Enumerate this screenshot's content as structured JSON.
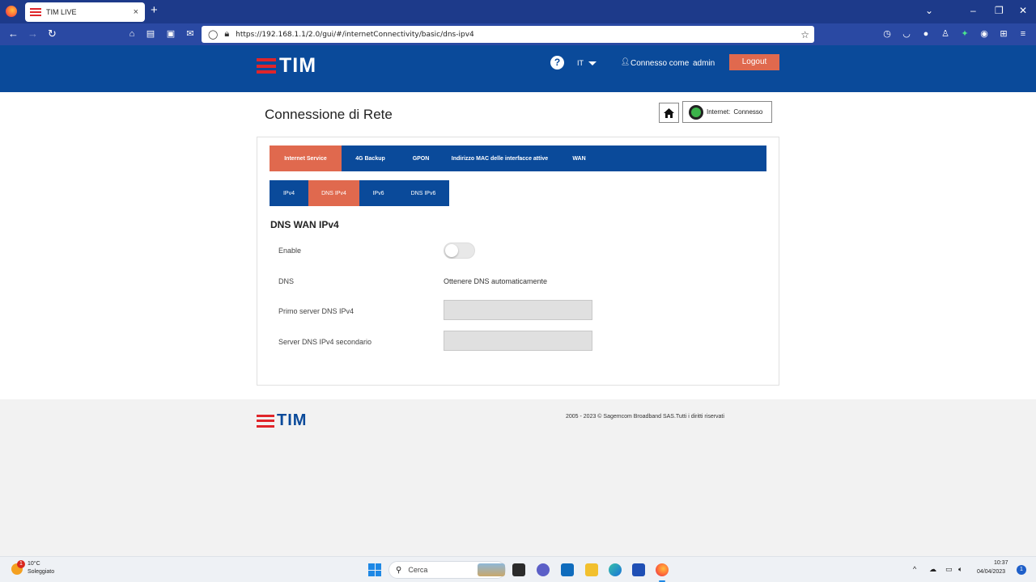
{
  "browser": {
    "tab_title": "TIM LIVE",
    "tab_close": "×",
    "new_tab": "+",
    "url": "https://192.168.1.1/2.0/gui/#/internetConnectivity/basic/dns-ipv4",
    "window_controls": {
      "dropdown": "⌄",
      "minimize": "–",
      "restore": "❐",
      "close": "✕"
    },
    "nav": {
      "back": "←",
      "forward": "→",
      "reload": "↻"
    }
  },
  "header": {
    "brand": "TIM",
    "help": "?",
    "language": "IT",
    "connected_as_label": "Connesso come",
    "username": "admin",
    "logout_label": "Logout"
  },
  "page": {
    "title": "Connessione di Rete",
    "status_label": "Internet:",
    "status_value": "Connesso"
  },
  "tabs_main": [
    {
      "label": "Internet Service",
      "active": true
    },
    {
      "label": "4G Backup",
      "active": false
    },
    {
      "label": "GPON",
      "active": false
    },
    {
      "label": "Indirizzo MAC delle interfacce attive",
      "active": false
    },
    {
      "label": "WAN",
      "active": false
    }
  ],
  "tabs_sub": [
    {
      "label": "IPv4",
      "active": false
    },
    {
      "label": "DNS IPv4",
      "active": true
    },
    {
      "label": "IPv6",
      "active": false
    },
    {
      "label": "DNS IPv6",
      "active": false
    }
  ],
  "form": {
    "section_title": "DNS WAN IPv4",
    "enable_label": "Enable",
    "enable_value": false,
    "dns_label": "DNS",
    "dns_value": "Ottenere DNS automaticamente",
    "primary_label": "Primo server DNS IPv4",
    "primary_value": "",
    "secondary_label": "Server DNS IPv4 secondario",
    "secondary_value": ""
  },
  "footer": {
    "brand": "TIM",
    "copyright": "2005 - 2023 © Sagemcom Broadband SAS.Tutti i diritti riservati"
  },
  "taskbar": {
    "weather_temp": "10°C",
    "weather_desc": "Soleggiato",
    "weather_badge": "1",
    "search_placeholder": "Cerca",
    "time": "10:37",
    "date": "04/04/2023",
    "notifications": "1"
  },
  "colors": {
    "tim_blue": "#0a4a9a",
    "tim_red": "#e0252a",
    "active_tab": "#e0694e",
    "browser_tabbar": "#1d3a8a",
    "browser_navbar": "#2a49a3"
  }
}
